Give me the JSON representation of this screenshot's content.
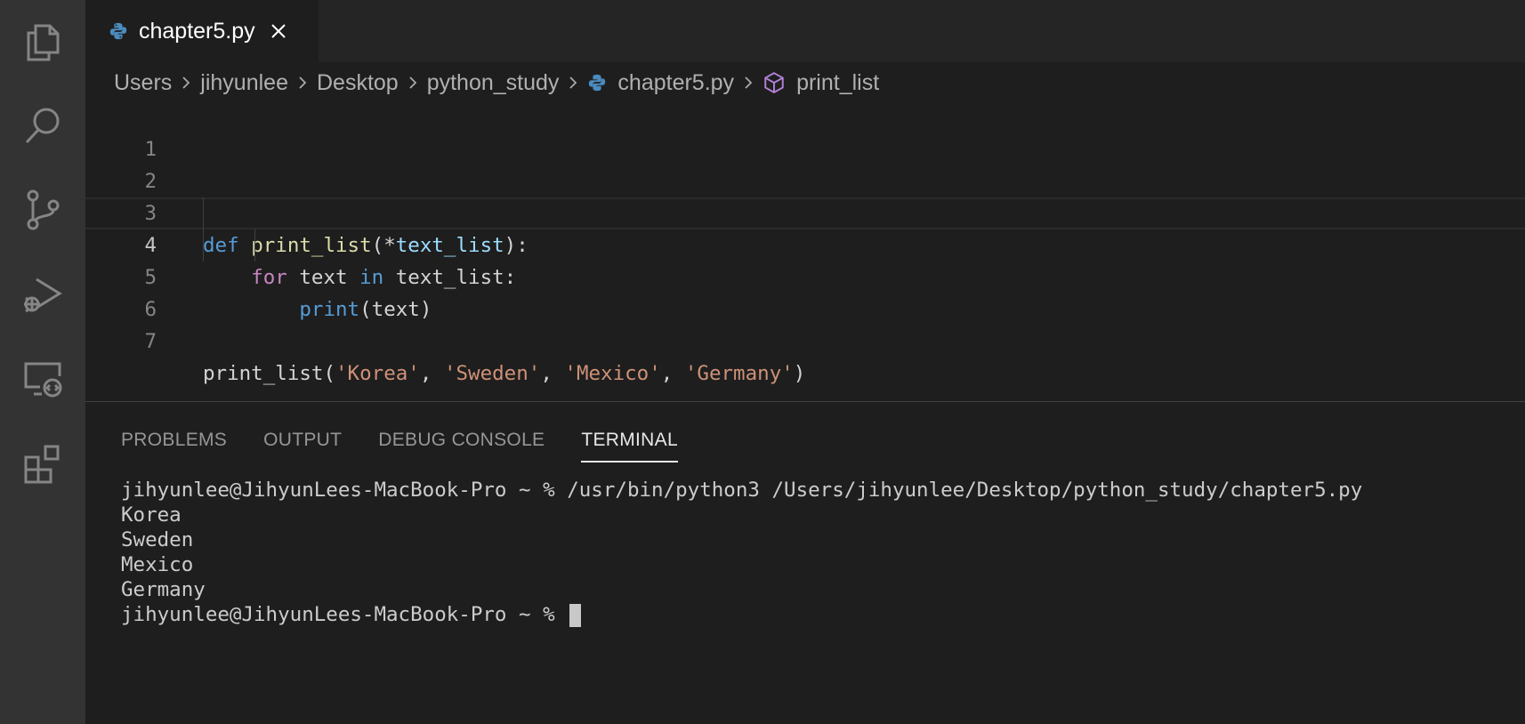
{
  "activity_bar": {
    "icons": [
      "explorer-icon",
      "search-icon",
      "source-control-icon",
      "run-debug-icon",
      "remote-explorer-icon",
      "extensions-icon"
    ]
  },
  "tab": {
    "label": "chapter5.py"
  },
  "breadcrumb": {
    "items": [
      "Users",
      "jihyunlee",
      "Desktop",
      "python_study",
      "chapter5.py",
      "print_list"
    ]
  },
  "editor": {
    "current_line": 4,
    "line_numbers": [
      "1",
      "2",
      "3",
      "4",
      "5",
      "6",
      "7"
    ],
    "lines": [
      "",
      "",
      "def print_list(*text_list):",
      "    for text in text_list:",
      "        print(text)",
      "",
      "print_list('Korea', 'Sweden', 'Mexico', 'Germany')"
    ],
    "tokens": {
      "l3": {
        "def": "def",
        "fn": "print_list",
        "open": "(",
        "star": "*",
        "param": "text_list",
        "close": "):"
      },
      "l4": {
        "for": "for",
        "var1": "text",
        "in": "in",
        "var2": "text_list",
        "colon": ":"
      },
      "l5": {
        "print": "print",
        "open": "(",
        "arg": "text",
        "close": ")"
      },
      "l7": {
        "fn": "print_list",
        "open": "(",
        "s1": "'Korea'",
        "c1": ", ",
        "s2": "'Sweden'",
        "c2": ", ",
        "s3": "'Mexico'",
        "c3": ", ",
        "s4": "'Germany'",
        "close": ")"
      }
    }
  },
  "panel": {
    "tabs": [
      "PROBLEMS",
      "OUTPUT",
      "DEBUG CONSOLE",
      "TERMINAL"
    ],
    "active_tab": "TERMINAL"
  },
  "terminal": {
    "lines": [
      "jihyunlee@JihyunLees-MacBook-Pro ~ % /usr/bin/python3 /Users/jihyunlee/Desktop/python_study/chapter5.py",
      "Korea",
      "Sweden",
      "Mexico",
      "Germany"
    ],
    "prompt": "jihyunlee@JihyunLees-MacBook-Pro ~ % "
  },
  "colors": {
    "keyword": "#569cd6",
    "control_keyword": "#c586c0",
    "function": "#dcdcaa",
    "variable": "#9cdcfe",
    "string": "#ce9178",
    "background": "#1e1e1e",
    "activity_bar": "#333333"
  }
}
